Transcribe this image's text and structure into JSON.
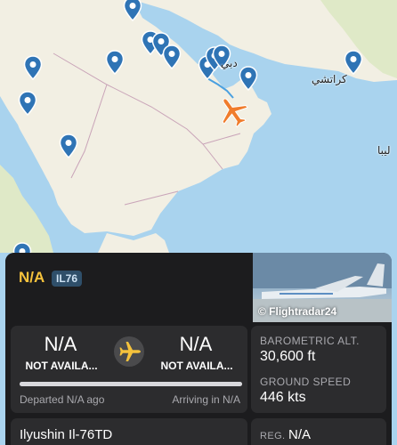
{
  "map": {
    "labels": {
      "dubai": "دبي",
      "karachi": "كراتشي",
      "right_edge": "ليبا"
    },
    "colors": {
      "water": "#a9d3ee",
      "land": "#f2efe3",
      "land_green": "#dfe9c7",
      "border": "#c9a4b8",
      "pin": "#2f74b5",
      "plane": "#f07c2c",
      "trail": "#4aa0e0"
    }
  },
  "flight": {
    "callsign": "N/A",
    "aircraft_code": "IL76",
    "photo_credit": "© Flightradar24",
    "origin": {
      "code": "N/A",
      "name": "NOT AVAILA..."
    },
    "destination": {
      "code": "N/A",
      "name": "NOT AVAILA..."
    },
    "departed_text": "Departed N/A ago",
    "arriving_text": "Arriving in N/A",
    "progress_fraction": 1.0,
    "barometric_label": "BAROMETRIC ALT.",
    "barometric_value": "30,600 ft",
    "ground_speed_label": "GROUND SPEED",
    "ground_speed_value": "446 kts",
    "aircraft_name": "Ilyushin Il-76TD",
    "reg_label": "REG.",
    "reg_value": "N/A"
  }
}
